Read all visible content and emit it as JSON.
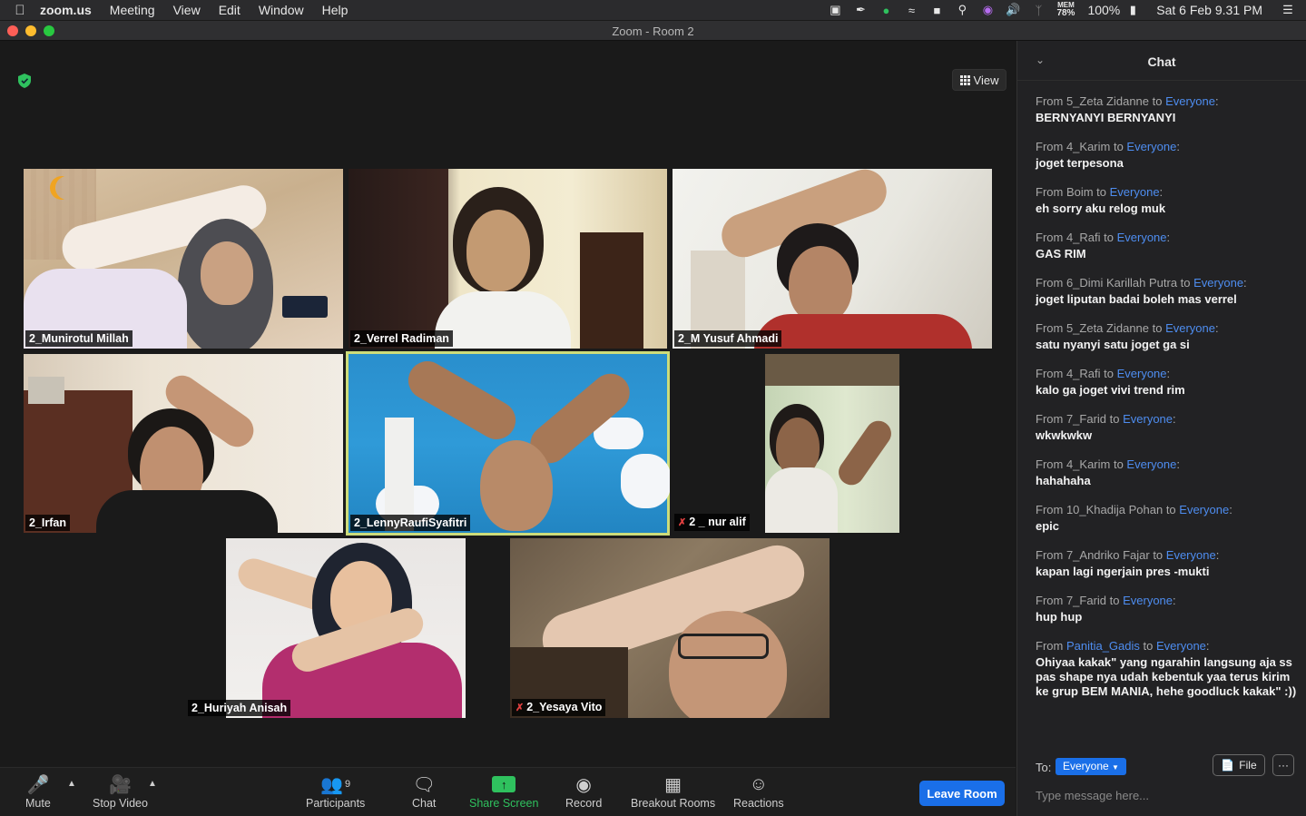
{
  "menubar": {
    "app": "zoom.us",
    "items": [
      "Meeting",
      "View",
      "Edit",
      "Window",
      "Help"
    ],
    "mem": "MEM",
    "mem_value": "78%",
    "battery": "100%",
    "datetime": "Sat 6 Feb  9.31 PM"
  },
  "window": {
    "title": "Zoom - Room 2"
  },
  "view_button": {
    "label": "View"
  },
  "participants": [
    {
      "name": "2_Munirotul Millah",
      "muted": false,
      "active": false
    },
    {
      "name": "2_Verrel Radiman",
      "muted": false,
      "active": false
    },
    {
      "name": "2_M Yusuf Ahmadi",
      "muted": false,
      "active": false
    },
    {
      "name": "2_Irfan",
      "muted": false,
      "active": false
    },
    {
      "name": "2_LennyRaufiSyafitri",
      "muted": false,
      "active": true
    },
    {
      "name": "2 _ nur alif",
      "muted": true,
      "active": false
    },
    {
      "name": "2_Huriyah Anisah",
      "muted": false,
      "active": false
    },
    {
      "name": "2_Yesaya Vito",
      "muted": true,
      "active": false
    }
  ],
  "toolbar": {
    "mute": "Mute",
    "stop_video": "Stop Video",
    "participants": "Participants",
    "participants_count": "9",
    "chat": "Chat",
    "share_screen": "Share Screen",
    "record": "Record",
    "breakout_rooms": "Breakout Rooms",
    "reactions": "Reactions",
    "leave": "Leave Room",
    "share_color": "#2fc15e",
    "leave_color": "#1a6fe8"
  },
  "chat": {
    "title": "Chat",
    "messages": [
      {
        "from_prefix": "From 5_Zeta Zidanne to ",
        "to": "Everyone",
        "text": "BERNYANYI BERNYANYI"
      },
      {
        "from_prefix": "From 4_Karim to ",
        "to": "Everyone",
        "text": "joget terpesona"
      },
      {
        "from_prefix": "From Boim to ",
        "to": "Everyone",
        "text": "eh sorry aku relog muk"
      },
      {
        "from_prefix": "From 4_Rafi to ",
        "to": "Everyone",
        "text": "GAS RIM"
      },
      {
        "from_prefix": "From 6_Dimi Karillah Putra to ",
        "to": "Everyone",
        "text": "joget liputan badai boleh mas verrel"
      },
      {
        "from_prefix": "From 5_Zeta Zidanne to ",
        "to": "Everyone",
        "text": "satu nyanyi satu joget ga si"
      },
      {
        "from_prefix": "From 4_Rafi to ",
        "to": "Everyone",
        "text": "kalo ga joget vivi trend rim"
      },
      {
        "from_prefix": "From 7_Farid to ",
        "to": "Everyone",
        "text": "wkwkwkw"
      },
      {
        "from_prefix": "From 4_Karim to ",
        "to": "Everyone",
        "text": "hahahaha"
      },
      {
        "from_prefix": "From 10_Khadija Pohan to ",
        "to": "Everyone",
        "text": "epic"
      },
      {
        "from_prefix": "From 7_Andriko Fajar to ",
        "to": "Everyone",
        "text": "kapan lagi ngerjain pres -mukti"
      },
      {
        "from_prefix": "From 7_Farid to ",
        "to": "Everyone",
        "text": "hup hup"
      }
    ],
    "last_message": {
      "from": "From ",
      "sender": "Panitia_Gadis",
      "to_word": " to ",
      "to": "Everyone",
      "text": "Ohiyaa kakak\" yang ngarahin langsung aja ss pas shape nya udah kebentuk yaa terus kirim ke grup BEM MANIA, hehe goodluck kakak\" :))"
    },
    "to_label": "To:",
    "recipient": "Everyone",
    "file_label": "File",
    "more_label": "···",
    "placeholder": "Type message here..."
  }
}
